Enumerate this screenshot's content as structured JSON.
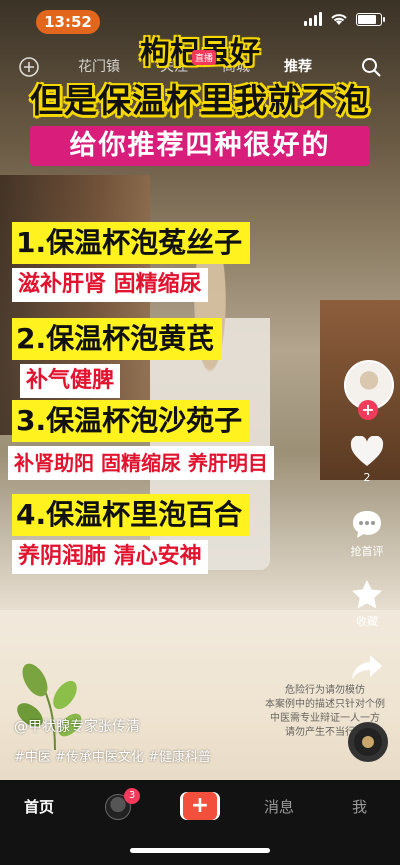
{
  "status_bar": {
    "time": "13:52"
  },
  "top_nav": {
    "items": [
      "花门镇",
      "关注",
      "商城",
      "推荐"
    ],
    "live_badge": "直播"
  },
  "overlay": {
    "title_line1": "枸杞虽好",
    "title_line2": "但是保温杯里我就不泡",
    "subtitle": "给你推荐四种很好的",
    "items": [
      {
        "head": "1.保温杯泡菟丝子",
        "sub": "滋补肝肾 固精缩尿"
      },
      {
        "head": "2.保温杯泡黄芪",
        "sub": "补气健脾"
      },
      {
        "head": "3.保温杯泡沙苑子",
        "sub": "补肾助阳 固精缩尿 养肝明目"
      },
      {
        "head": "4.保温杯里泡百合",
        "sub": "养阴润肺 清心安神"
      }
    ]
  },
  "rail": {
    "like_count": "2",
    "comment_label": "抢首评",
    "favorite_label": "收藏"
  },
  "video_info": {
    "author": "@甲状腺专家张传清",
    "tags": "#中医 #传承中医文化 #健康科普",
    "disclaimer": "危险行为请勿模仿\n本案例中的描述只针对个例\n中医需专业辩证一人一方\n请勿产生不当行为"
  },
  "tabbar": {
    "home": "首页",
    "friends_badge": "3",
    "plus": "+",
    "messages": "消息",
    "me": "我"
  },
  "colors": {
    "accent_yellow": "#fff21e",
    "banner_pink": "#d81e7a",
    "sub_red": "#e2132f",
    "time_pill": "#e2661b"
  }
}
